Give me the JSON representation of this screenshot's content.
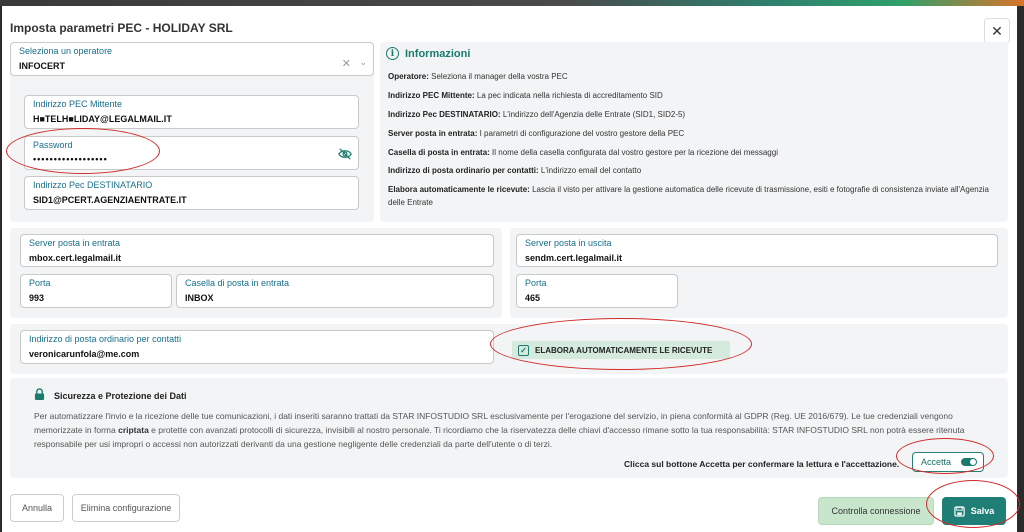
{
  "dialog": {
    "title": "Imposta parametri PEC - HOLIDAY SRL",
    "close_glyph": "✕"
  },
  "operator": {
    "label": "Seleziona un operatore",
    "value": "INFOCERT",
    "clear_glyph": "✕",
    "chevron_glyph": "⌄"
  },
  "sender": {
    "pec_label": "Indirizzo PEC Mittente",
    "pec_value": "H■TELH■LIDAY@LEGALMAIL.IT",
    "password_label": "Password",
    "password_value": "••••••••••••••••••",
    "dest_label": "Indirizzo Pec DESTINATARIO",
    "dest_value": "SID1@PCERT.AGENZIAENTRATE.IT"
  },
  "info": {
    "title": "Informazioni",
    "lines": [
      {
        "key": "Operatore:",
        "text": "Seleziona il manager della vostra PEC"
      },
      {
        "key": "Indirizzo PEC Mittente:",
        "text": "La pec indicata nella richiesta di accreditamento SID"
      },
      {
        "key": "Indirizzo Pec DESTINATARIO:",
        "text": "L'indirizzo dell'Agenzia delle Entrate (SID1, SID2-5)"
      },
      {
        "key": "Server posta in entrata:",
        "text": "I parametri di configurazione del vostro gestore della PEC"
      },
      {
        "key": "Casella di posta in entrata:",
        "text": "Il nome della casella configurata dal vostro gestore per la ricezione dei messaggi"
      },
      {
        "key": "Indirizzo di posta ordinario per contatti:",
        "text": "L'indirizzo email del contatto"
      },
      {
        "key": "Elabora automaticamente le ricevute:",
        "text": "Lascia il visto per attivare la gestione automatica delle ricevute di trasmissione, esiti e fotografie di consistenza inviate all'Agenzia delle Entrate"
      }
    ]
  },
  "incoming": {
    "server_label": "Server posta in entrata",
    "server_value": "mbox.cert.legalmail.it",
    "port_label": "Porta",
    "port_value": "993",
    "box_label": "Casella di posta in entrata",
    "box_value": "INBOX"
  },
  "outgoing": {
    "server_label": "Server posta in uscita",
    "server_value": "sendm.cert.legalmail.it",
    "port_label": "Porta",
    "port_value": "465"
  },
  "contact": {
    "label": "Indirizzo di posta ordinario per contatti",
    "value": "veronicarunfola@me.com"
  },
  "auto_receipts": {
    "label": "ELABORA AUTOMATICAMENTE LE RICEVUTE",
    "checked": true,
    "check_glyph": "✓"
  },
  "security": {
    "title": "Sicurezza e Protezione dei Dati",
    "p1": "Per automatizzare l'invio e la ricezione delle tue comunicazioni, i dati inseriti saranno trattati da STAR INFOSTUDIO SRL esclusivamente per l'erogazione del servizio, in piena conformità al GDPR (Reg. UE 2016/679). Le tue credenziali vengono memorizzate in forma ",
    "bold": "criptata",
    "p2": " e protette con avanzati protocolli di sicurezza, invisibili al nostro personale. Ti ricordiamo che la riservatezza delle chiavi d'accesso rimane sotto la tua responsabilità: STAR INFOSTUDIO SRL non potrà essere ritenuta responsabile per usi impropri o accessi non autorizzati derivanti da una gestione negligente delle credenziali da parte dell'utente o di terzi.",
    "accept_prompt": "Clicca sul bottone Accetta per confermare la lettura e l'accettazione.",
    "accept_label": "Accetta",
    "accepted": true
  },
  "footer": {
    "cancel": "Annulla",
    "delete": "Elimina configurazione",
    "test": "Controlla connessione",
    "save": "Salva"
  },
  "colors": {
    "accent": "#1f7f77",
    "annotation": "#d02a2a"
  }
}
